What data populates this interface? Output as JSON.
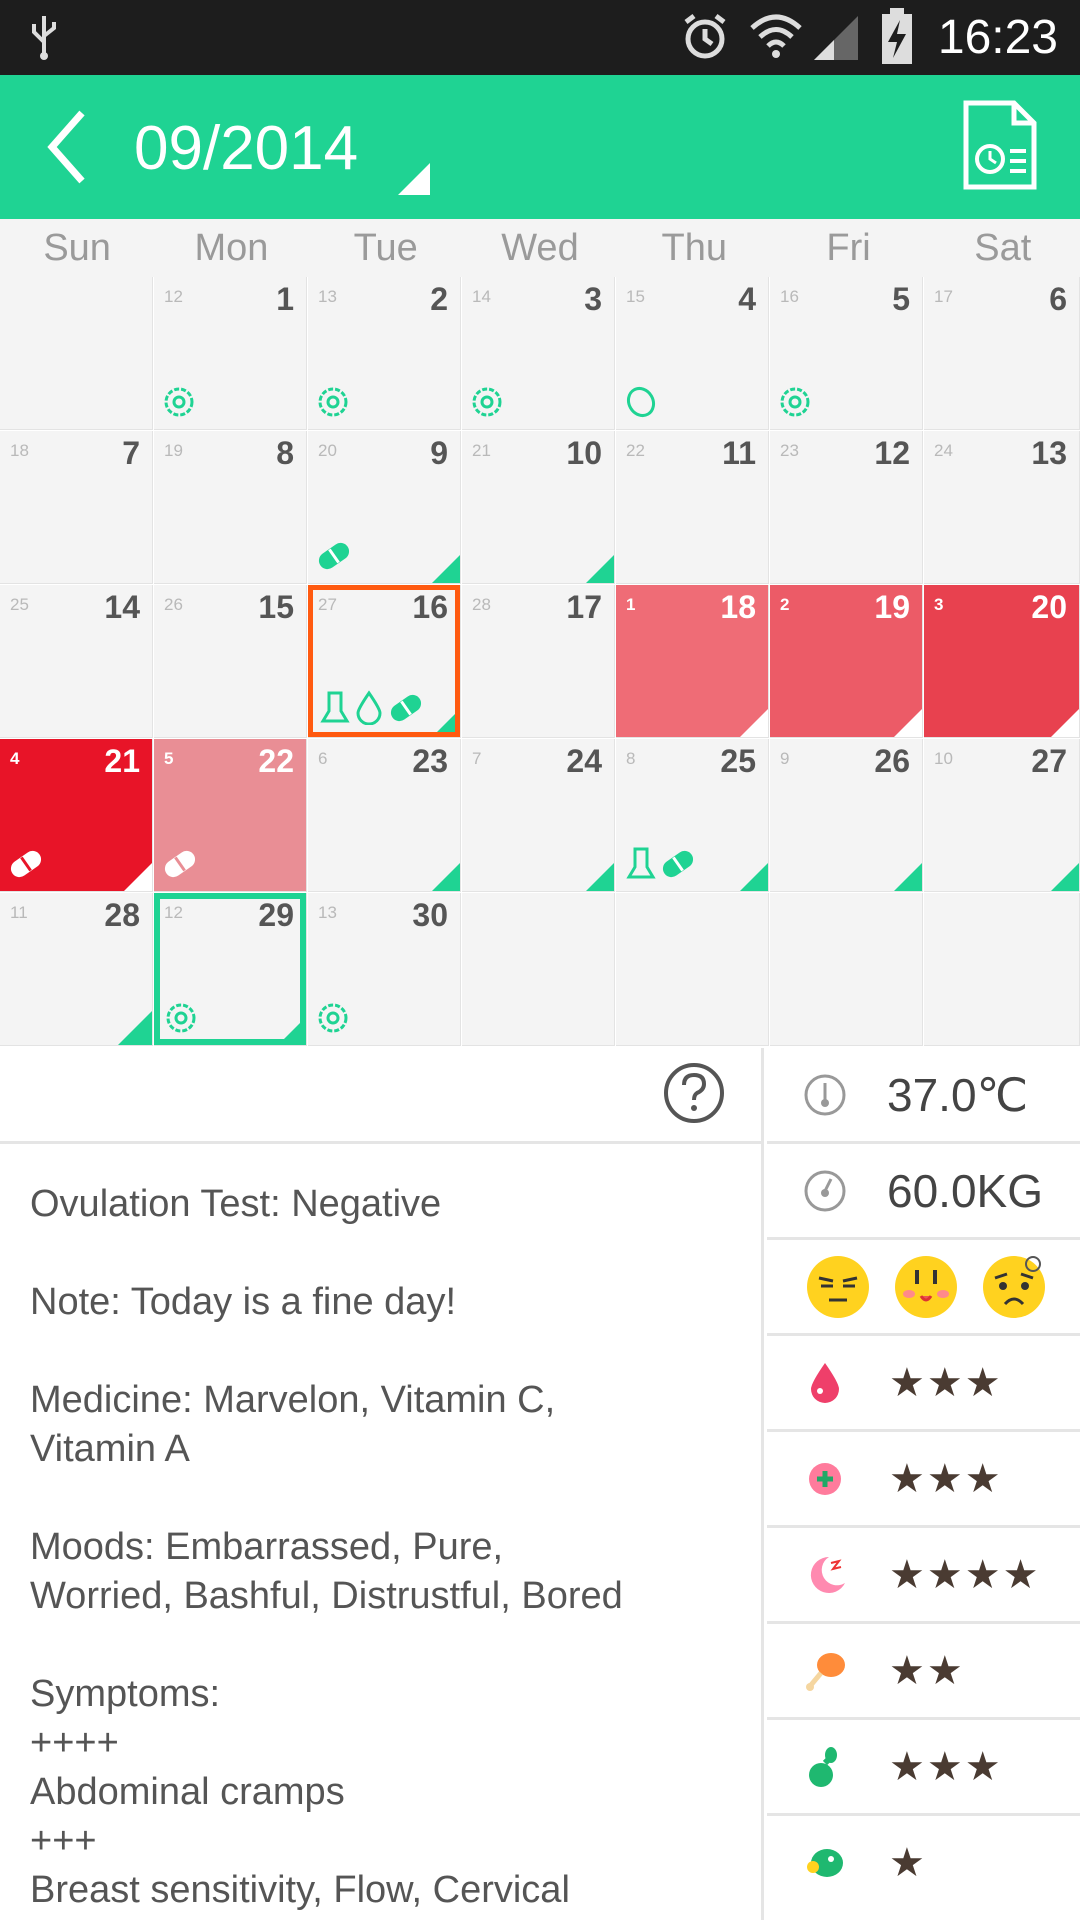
{
  "status_bar": {
    "time": "16:23"
  },
  "header": {
    "month": "09/2014"
  },
  "weekdays": [
    "Sun",
    "Mon",
    "Tue",
    "Wed",
    "Thu",
    "Fri",
    "Sat"
  ],
  "calendar": {
    "rows": [
      [
        {
          "day": "",
          "cycle": ""
        },
        {
          "day": "1",
          "cycle": "12"
        },
        {
          "day": "2",
          "cycle": "13"
        },
        {
          "day": "3",
          "cycle": "14"
        },
        {
          "day": "4",
          "cycle": "15"
        },
        {
          "day": "5",
          "cycle": "16"
        },
        {
          "day": "6",
          "cycle": "17"
        }
      ],
      [
        {
          "day": "7",
          "cycle": "18"
        },
        {
          "day": "8",
          "cycle": "19"
        },
        {
          "day": "9",
          "cycle": "20"
        },
        {
          "day": "10",
          "cycle": "21"
        },
        {
          "day": "11",
          "cycle": "22"
        },
        {
          "day": "12",
          "cycle": "23"
        },
        {
          "day": "13",
          "cycle": "24"
        }
      ],
      [
        {
          "day": "14",
          "cycle": "25"
        },
        {
          "day": "15",
          "cycle": "26"
        },
        {
          "day": "16",
          "cycle": "27"
        },
        {
          "day": "17",
          "cycle": "28"
        },
        {
          "day": "18",
          "cycle": "1"
        },
        {
          "day": "19",
          "cycle": "2"
        },
        {
          "day": "20",
          "cycle": "3"
        }
      ],
      [
        {
          "day": "21",
          "cycle": "4"
        },
        {
          "day": "22",
          "cycle": "5"
        },
        {
          "day": "23",
          "cycle": "6"
        },
        {
          "day": "24",
          "cycle": "7"
        },
        {
          "day": "25",
          "cycle": "8"
        },
        {
          "day": "26",
          "cycle": "9"
        },
        {
          "day": "27",
          "cycle": "10"
        }
      ],
      [
        {
          "day": "28",
          "cycle": "11"
        },
        {
          "day": "29",
          "cycle": "12"
        },
        {
          "day": "30",
          "cycle": "13"
        },
        {
          "day": "",
          "cycle": ""
        },
        {
          "day": "",
          "cycle": ""
        },
        {
          "day": "",
          "cycle": ""
        },
        {
          "day": "",
          "cycle": ""
        }
      ]
    ]
  },
  "detail": {
    "text": "Ovulation Test:  Negative\n\nNote:  Today is a fine day!\n\nMedicine:  Marvelon,  Vitamin C,\nVitamin A\n\nMoods:  Embarrassed,  Pure,\nWorried,  Bashful,  Distrustful,  Bored\n\nSymptoms:\n++++\nAbdominal cramps\n+++\nBreast sensitivity,  Flow,  Cervical"
  },
  "side": {
    "temperature": "37.0℃",
    "weight": "60.0KG",
    "ratings": [
      {
        "icon": "flow-drop-icon",
        "stars": "★★★",
        "level": 3
      },
      {
        "icon": "health-plus-icon",
        "stars": "★★★",
        "level": 3
      },
      {
        "icon": "sleep-moon-icon",
        "stars": "★★★★",
        "level": 4
      },
      {
        "icon": "food-drumstick-icon",
        "stars": "★★",
        "level": 2
      },
      {
        "icon": "exercise-icon",
        "stars": "★★★",
        "level": 3
      },
      {
        "icon": "mind-head-icon",
        "stars": "★",
        "level": 1
      }
    ]
  },
  "colors": {
    "accent": "#1fd393",
    "period1": "#ef6c76",
    "period2": "#ec5b67",
    "period3": "#e8414f",
    "period4": "#e81428",
    "period5": "#e98e95",
    "selected": "#ff5a10"
  }
}
